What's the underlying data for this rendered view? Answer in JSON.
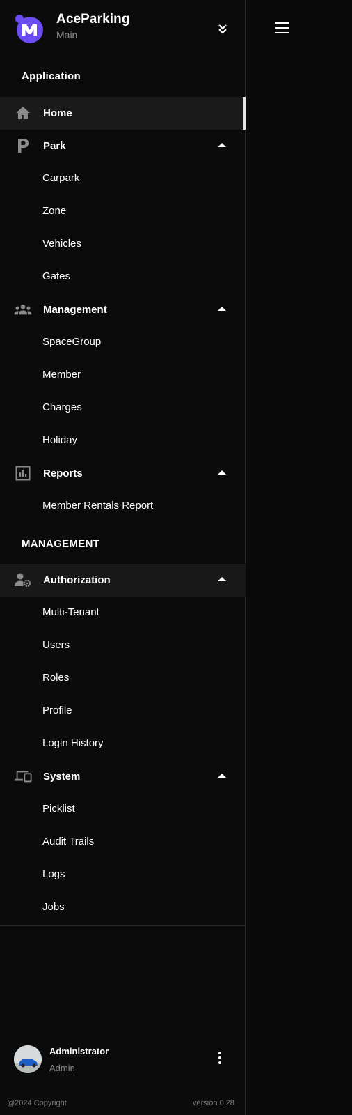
{
  "brand": {
    "title": "AceParking",
    "subtitle": "Main",
    "logo_icon": "m-logo-icon",
    "logo_color": "#6b4cf2"
  },
  "sections": {
    "application": "Application",
    "management": "MANAGEMENT"
  },
  "nav": {
    "home": {
      "label": "Home",
      "icon": "home-icon"
    },
    "park": {
      "label": "Park",
      "icon": "parking-p-icon",
      "items": [
        "Carpark",
        "Zone",
        "Vehicles",
        "Gates"
      ]
    },
    "management": {
      "label": "Management",
      "icon": "group-icon",
      "items": [
        "SpaceGroup",
        "Member",
        "Charges",
        "Holiday"
      ]
    },
    "reports": {
      "label": "Reports",
      "icon": "chart-icon",
      "items": [
        "Member Rentals Report"
      ]
    },
    "authorization": {
      "label": "Authorization",
      "icon": "user-gear-icon",
      "items": [
        "Multi-Tenant",
        "Users",
        "Roles",
        "Profile",
        "Login History"
      ]
    },
    "system": {
      "label": "System",
      "icon": "devices-icon",
      "items": [
        "Picklist",
        "Audit Trails",
        "Logs",
        "Jobs"
      ]
    }
  },
  "user": {
    "name": "Administrator",
    "role": "Admin"
  },
  "footer": {
    "copyright": "@2024 Copyright",
    "version": "version 0.28"
  },
  "colors": {
    "accent": "#6b4cf2",
    "background": "#0c0b0b",
    "active_bg": "#1b1a1a",
    "muted_text": "#8d8d8d"
  }
}
